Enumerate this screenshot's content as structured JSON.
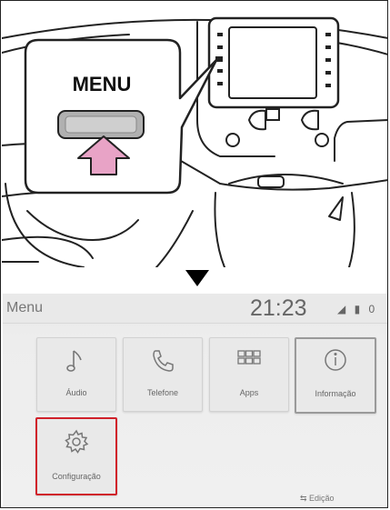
{
  "callout": {
    "menu_label": "MENU"
  },
  "screen": {
    "title": "Menu",
    "clock": "21:23",
    "status_icons": "◢ ▮ 0",
    "tiles": [
      {
        "label": "Áudio",
        "icon": "music-note-icon"
      },
      {
        "label": "Telefone",
        "icon": "phone-icon"
      },
      {
        "label": "Apps",
        "icon": "apps-grid-icon"
      },
      {
        "label": "Informação",
        "icon": "info-icon"
      },
      {
        "label": "Configuração",
        "icon": "gear-icon"
      }
    ],
    "edit_label": "Edição",
    "highlight_color": "#d0202a",
    "pointer_color": "#e8a3c6"
  }
}
